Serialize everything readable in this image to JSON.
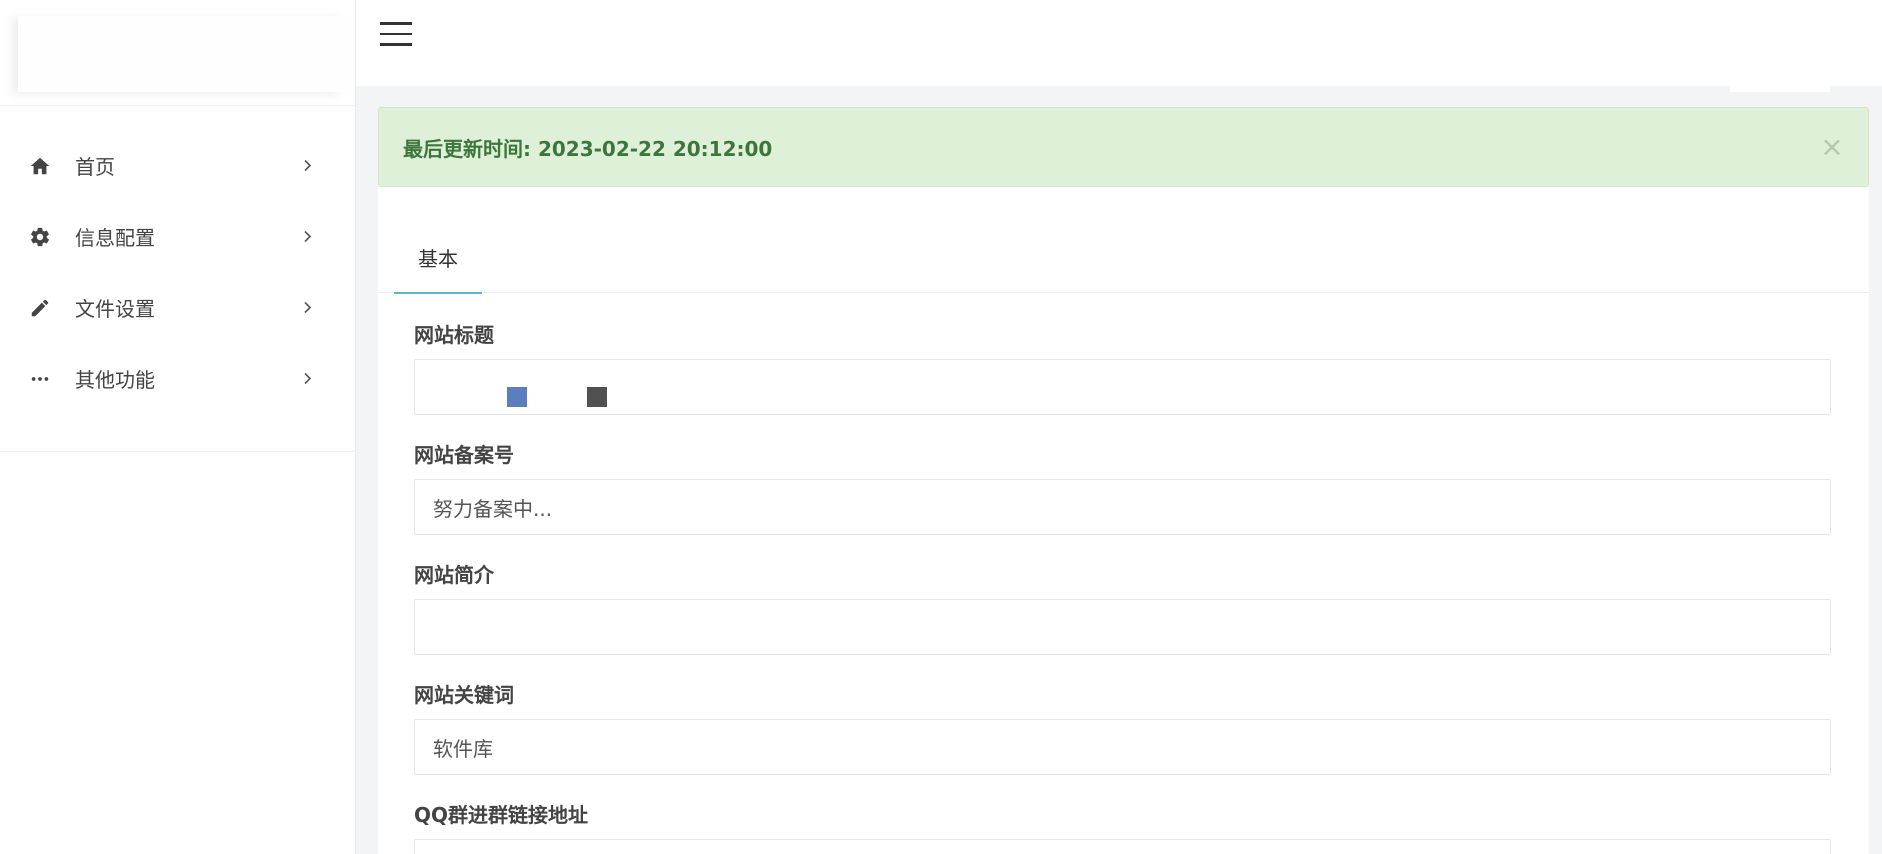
{
  "sidebar": {
    "items": [
      {
        "label": "首页",
        "icon": "home-icon"
      },
      {
        "label": "信息配置",
        "icon": "gear-icon"
      },
      {
        "label": "文件设置",
        "icon": "pencil-icon"
      },
      {
        "label": "其他功能",
        "icon": "more-dots-icon"
      }
    ]
  },
  "alert": {
    "text": "最后更新时间: 2023-02-22 20:12:00",
    "close": "×"
  },
  "tabs": [
    {
      "label": "基本"
    }
  ],
  "form": {
    "fields": [
      {
        "label": "网站标题",
        "value": ""
      },
      {
        "label": "网站备案号",
        "value": "努力备案中..."
      },
      {
        "label": "网站简介",
        "value": ""
      },
      {
        "label": "网站关键词",
        "value": "软件库"
      },
      {
        "label": "QQ群进群链接地址",
        "value": ""
      }
    ]
  },
  "colors": {
    "alert_bg": "#dff0d8",
    "alert_text": "#3c763d",
    "tab_active": "#5bb7d8",
    "square_blue": "#5b7fbe",
    "square_gray": "#505050"
  }
}
